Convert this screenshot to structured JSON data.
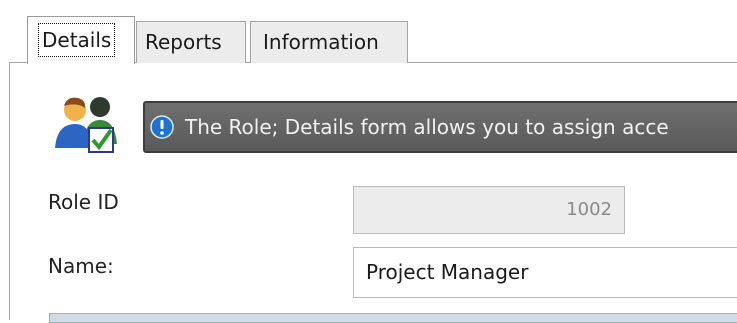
{
  "tabs": [
    {
      "label": "Details",
      "active": true
    },
    {
      "label": "Reports",
      "active": false
    },
    {
      "label": "Information",
      "active": false
    }
  ],
  "header": {
    "icon": "role-users-icon",
    "info_icon": "info-icon",
    "info_text": "The Role; Details form allows you to assign acce"
  },
  "form": {
    "role_id_label": "Role ID",
    "role_id_value": "1002",
    "name_label": "Name:",
    "name_value": "Project Manager"
  },
  "colors": {
    "info_bar": "#626262",
    "info_icon": "#1e73d2",
    "readonly_field": "#ececec"
  }
}
